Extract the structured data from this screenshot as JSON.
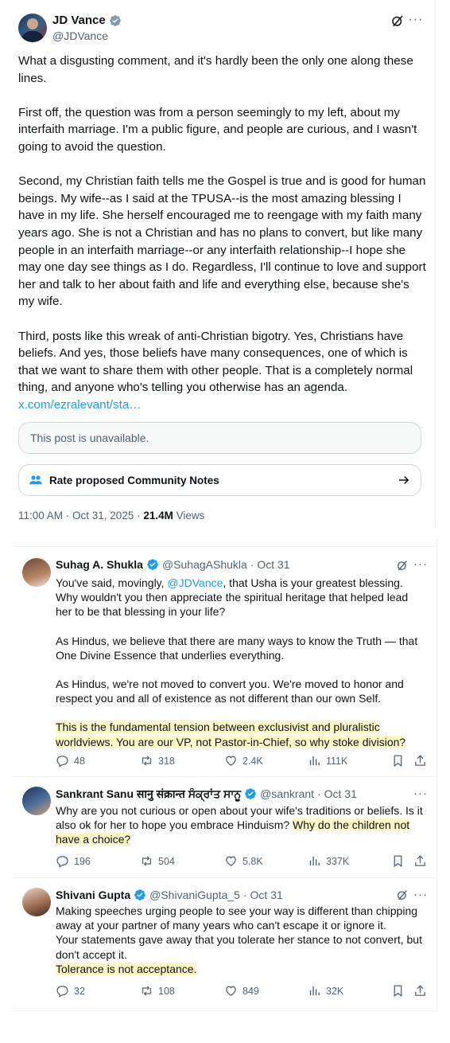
{
  "main_tweet": {
    "author_name": "JD Vance",
    "author_handle": "@JDVance",
    "paragraphs": [
      "What a disgusting comment, and it's hardly been the only one along these lines.",
      "First off, the question was from a person seemingly to my left, about my interfaith marriage. I'm a public figure, and people are curious, and I wasn't going to avoid the question.",
      "Second, my Christian faith tells me the Gospel is true and is good for human beings. My wife--as I said at the TPUSA--is the most amazing blessing I have in my life. She herself encouraged me to reengage with my faith many years ago. She is not a Christian and has no plans to convert, but like many people in an interfaith marriage--or any interfaith relationship--I hope she may one day see things as I do. Regardless, I'll continue to love and support her and talk to her about faith and life and everything else, because she's my wife.",
      "Third, posts like this wreak of anti-Christian bigotry. Yes, Christians have beliefs. And yes, those beliefs have many consequences, one of which is that we want to share them with other people. That is a completely normal thing, and anyone who's telling you otherwise has an agenda."
    ],
    "link_text": "x.com/ezralevant/sta…",
    "unavailable_text": "This post is unavailable.",
    "community_notes_label": "Rate proposed Community Notes",
    "timestamp": "11:00 AM · Oct 31, 2025 · ",
    "views_count": "21.4M",
    "views_label": " Views"
  },
  "replies": [
    {
      "author_name": "Suhag A. Shukla",
      "author_handle": "@SuhagAShukla",
      "date": "· Oct 31",
      "p1_before": "You've said, movingly, ",
      "p1_mention": "@JDVance",
      "p1_after": ", that Usha is your greatest blessing. Why wouldn't you then appreciate the spiritual heritage that helped lead her to be that blessing in your life?",
      "p2": "As Hindus, we believe that there are many ways to know the Truth — that One Divine Essence that underlies everything.",
      "p3": "As Hindus, we're not moved to convert you. We're moved to honor and respect you and all of existence as not different than our own Self.",
      "p4_highlight": "This is the fundamental tension between exclusivist and pluralistic worldviews. You are our VP, not Pastor-in-Chief, so why stoke division?",
      "replies": "48",
      "reposts": "318",
      "likes": "2.4K",
      "views": "111K"
    },
    {
      "author_name": "Sankrant Sanu सानु संक्रान्त ਸੰਕ੍ਰਾਂਤ ਸਾਨੂ",
      "author_handle": "@sankrant",
      "date": "· Oct 31",
      "text": "Why are you not curious or open about your wife's traditions or beliefs. Is it also ok for her to hope you embrace Hinduism? ",
      "highlight": "Why do the children not have a choice?",
      "replies": "196",
      "reposts": "504",
      "likes": "5.8K",
      "views": "337K"
    },
    {
      "author_name": "Shivani Gupta",
      "author_handle": "@ShivaniGupta_5",
      "date": "· Oct 31",
      "line1": "Making speeches urging people to see your way is different than chipping away at your partner of many years who can't escape it or ignore it.",
      "line2": "Your statements gave away that you tolerate her stance to not convert, but don't accept it.",
      "highlight": "Tolerance is not acceptance.",
      "replies": "32",
      "reposts": "108",
      "likes": "849",
      "views": "32K"
    }
  ],
  "colors": {
    "accent": "#1d9bf0",
    "highlight": "#fdf6c6",
    "muted": "#536471",
    "text": "#0f1419"
  },
  "icons": [
    "verified-badge-icon",
    "grok-icon",
    "more-icon",
    "people-icon",
    "arrow-right-icon",
    "reply-icon",
    "repost-icon",
    "like-icon",
    "views-icon",
    "bookmark-icon",
    "share-icon"
  ]
}
